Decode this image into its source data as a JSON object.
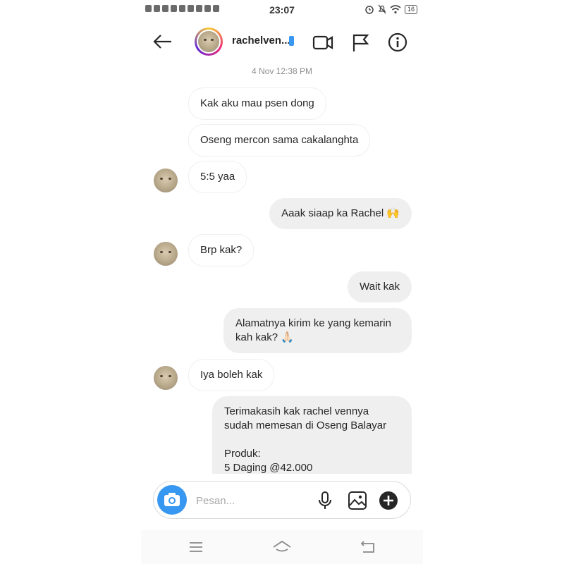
{
  "status_bar": {
    "time": "23:07",
    "battery": "16"
  },
  "header": {
    "username": "rachelven..."
  },
  "timestamp": "4 Nov 12:38 PM",
  "messages": [
    {
      "text": "Kak aku mau psen dong"
    },
    {
      "text": "Oseng mercon sama cakalanghta"
    },
    {
      "text": "5:5 yaa"
    },
    {
      "text": "Aaak siaap ka Rachel 🙌"
    },
    {
      "text": "Brp kak?"
    },
    {
      "text": "Wait kak"
    },
    {
      "text": "Alamatnya kirim ke yang kemarin\nkah kak? 🙏🏻"
    },
    {
      "text": "Iya boleh kak"
    },
    {
      "text": "Terimakasih kak rachel vennya\nsudah memesan di Oseng Balayar\n\nProduk:\n5 Daging @42.000"
    }
  ],
  "composer": {
    "placeholder": "Pesan..."
  },
  "colors": {
    "accent": "#3897f0",
    "sent_bubble": "#efefef",
    "text": "#262626",
    "muted": "#8e8e8e"
  }
}
